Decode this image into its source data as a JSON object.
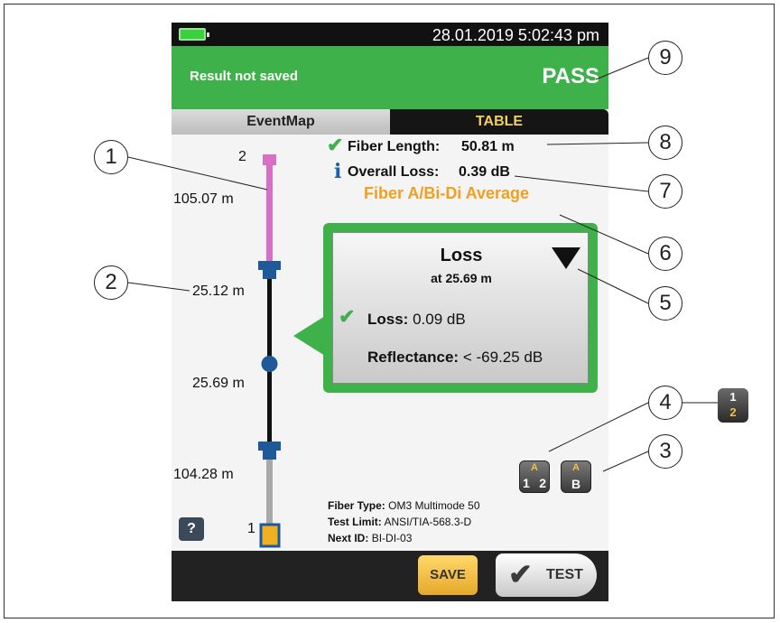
{
  "status_bar": {
    "datetime": "28.01.2019 5:02:43 pm"
  },
  "result": {
    "message": "Result not saved",
    "verdict": "PASS"
  },
  "tabs": [
    {
      "label": "EventMap"
    },
    {
      "label": "TABLE"
    }
  ],
  "event_map": {
    "end_labels": {
      "top": "2",
      "bottom": "1"
    },
    "distances": [
      "105.07 m",
      "25.12 m",
      "25.69 m",
      "104.28 m"
    ],
    "colors": {
      "launch": "#d86fc4",
      "fiber": "#111111",
      "tail": "#a8a8a8",
      "connector": "#1e5a9a"
    }
  },
  "summary": {
    "fiber_length_label": "Fiber Length:",
    "fiber_length_value": "50.81 m",
    "overall_loss_label": "Overall Loss:",
    "overall_loss_value": "0.39 dB",
    "average_label": "Fiber A/Bi-Di Average"
  },
  "event": {
    "title": "Loss",
    "subtitle": "at 25.69 m",
    "loss_label": "Loss:",
    "loss_value": "0.09 dB",
    "reflectance_label": "Reflectance:",
    "reflectance_value": "< -69.25 dB"
  },
  "fiber_info": {
    "type_label": "Fiber Type:",
    "type_value": "OM3 Multimode 50",
    "limit_label": "Test Limit:",
    "limit_value": "ANSI/TIA-568.3-D",
    "next_label": "Next ID:",
    "next_value": "BI-DI-03"
  },
  "buttons": {
    "help": "?",
    "save": "SAVE",
    "test": "TEST"
  },
  "icons": {
    "swap_ends": "swap-ends-icon",
    "swap_ab": "swap-ab-icon",
    "side_swap": "swap-12-icon",
    "swap_ends_top": "A",
    "swap_ends_left": "1",
    "swap_ends_right": "2",
    "swap_ab_top": "A",
    "swap_ab_bottom": "B",
    "side_top": "1",
    "side_bottom": "2"
  },
  "callouts": [
    "1",
    "2",
    "3",
    "4",
    "5",
    "6",
    "7",
    "8",
    "9"
  ],
  "accent_colors": {
    "pass_green": "#3fb14a",
    "warning_orange": "#f0a020",
    "table_tab_text": "#f0d060"
  }
}
